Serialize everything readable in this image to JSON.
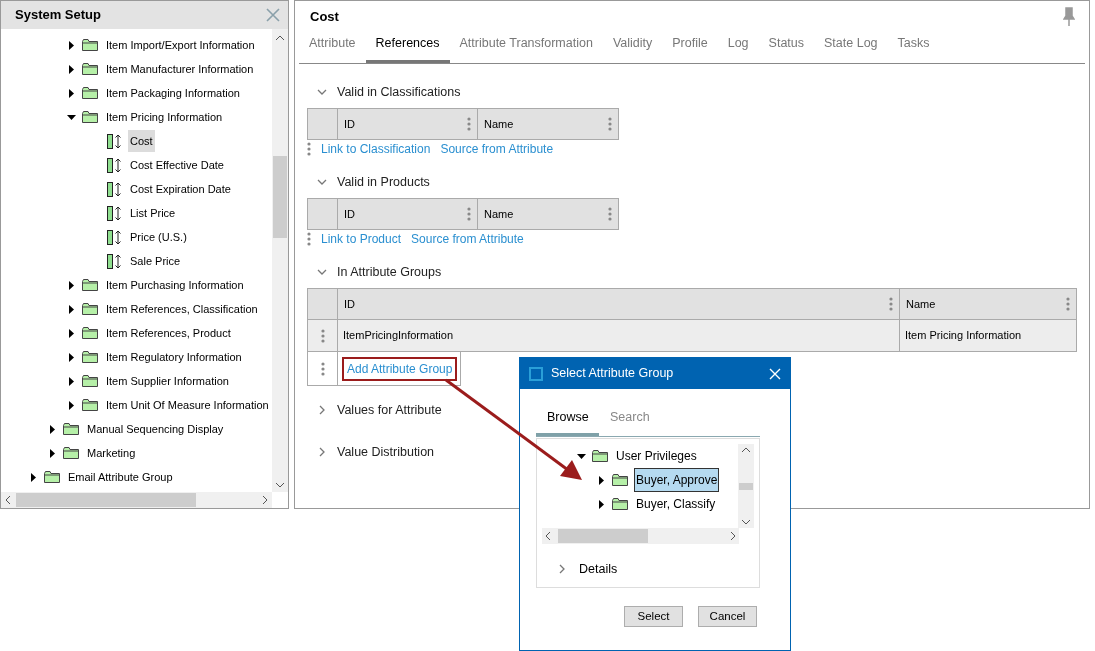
{
  "sidebar": {
    "title": "System Setup",
    "tree": [
      {
        "children": [
          {
            "children": [
              {
                "label": "Item Import/Export Information",
                "kind": "group",
                "expanded": false,
                "selected": false
              },
              {
                "label": "Item Manufacturer Information",
                "kind": "group",
                "expanded": false,
                "selected": false
              },
              {
                "label": "Item Packaging Information",
                "kind": "group",
                "expanded": false,
                "selected": false
              },
              {
                "label": "Item Pricing Information",
                "kind": "group",
                "expanded": true,
                "selected": false,
                "children": [
                  {
                    "label": "Cost",
                    "kind": "attribute",
                    "selected": true
                  },
                  {
                    "label": "Cost Effective Date",
                    "kind": "attribute",
                    "selected": false
                  },
                  {
                    "label": "Cost Expiration Date",
                    "kind": "attribute",
                    "selected": false
                  },
                  {
                    "label": "List Price",
                    "kind": "attribute",
                    "selected": false
                  },
                  {
                    "label": "Price (U.S.)",
                    "kind": "attribute",
                    "selected": false
                  },
                  {
                    "label": "Sale Price",
                    "kind": "attribute",
                    "selected": false
                  }
                ]
              },
              {
                "label": "Item Purchasing Information",
                "kind": "group",
                "expanded": false,
                "selected": false
              },
              {
                "label": "Item References, Classification",
                "kind": "group",
                "expanded": false,
                "selected": false
              },
              {
                "label": "Item References, Product",
                "kind": "group",
                "expanded": false,
                "selected": false
              },
              {
                "label": "Item Regulatory Information",
                "kind": "group",
                "expanded": false,
                "selected": false
              },
              {
                "label": "Item Supplier Information",
                "kind": "group",
                "expanded": false,
                "selected": false
              },
              {
                "label": "Item Unit Of Measure Information",
                "kind": "group",
                "expanded": false,
                "selected": false
              }
            ]
          },
          {
            "label": "Manual Sequencing Display",
            "kind": "group",
            "expanded": false,
            "selected": false
          },
          {
            "label": "Marketing",
            "kind": "group",
            "expanded": false,
            "selected": false
          }
        ]
      },
      {
        "label": "Email Attribute Group",
        "kind": "group",
        "expanded": false,
        "selected": false
      }
    ]
  },
  "editor": {
    "title": "Cost",
    "tabs": [
      {
        "label": "Attribute",
        "selected": false
      },
      {
        "label": "References",
        "selected": true
      },
      {
        "label": "Attribute Transformation",
        "selected": false
      },
      {
        "label": "Validity",
        "selected": false
      },
      {
        "label": "Profile",
        "selected": false
      },
      {
        "label": "Log",
        "selected": false
      },
      {
        "label": "Status",
        "selected": false
      },
      {
        "label": "State Log",
        "selected": false
      },
      {
        "label": "Tasks",
        "selected": false
      }
    ],
    "sections": [
      {
        "title": "Valid in Classifications",
        "expanded": true,
        "table": {
          "columns": [
            "ID",
            "Name"
          ]
        },
        "links": [
          {
            "label": "Link to Classification",
            "highlighted": false
          },
          {
            "label": "Source from Attribute",
            "highlighted": false
          }
        ]
      },
      {
        "title": "Valid in Products",
        "expanded": true,
        "table": {
          "columns": [
            "ID",
            "Name"
          ]
        },
        "links": [
          {
            "label": "Link to Product",
            "highlighted": false
          },
          {
            "label": "Source from Attribute",
            "highlighted": false
          }
        ]
      },
      {
        "title": "In Attribute Groups",
        "expanded": true,
        "table": {
          "columns": [
            "ID",
            "Name"
          ],
          "rows": [
            [
              "ItemPricingInformation",
              "Item Pricing Information"
            ]
          ]
        },
        "action": {
          "label": "Add Attribute Group",
          "highlighted": true
        }
      },
      {
        "title": "Values for Attribute",
        "expanded": false
      },
      {
        "title": "Value Distribution",
        "expanded": false
      }
    ]
  },
  "dialog": {
    "title": "Select Attribute Group",
    "tabs": [
      {
        "label": "Browse",
        "selected": true
      },
      {
        "label": "Search",
        "selected": false
      }
    ],
    "tree": [
      {
        "label": "User Privileges",
        "expanded": true,
        "selected": false,
        "children": [
          {
            "label": "Buyer, Approve",
            "expanded": false,
            "selected": true
          },
          {
            "label": "Buyer, Classify",
            "expanded": false,
            "selected": false
          }
        ]
      }
    ],
    "details": {
      "label": "Details",
      "expanded": false
    },
    "buttons": [
      "Select",
      "Cancel"
    ]
  }
}
